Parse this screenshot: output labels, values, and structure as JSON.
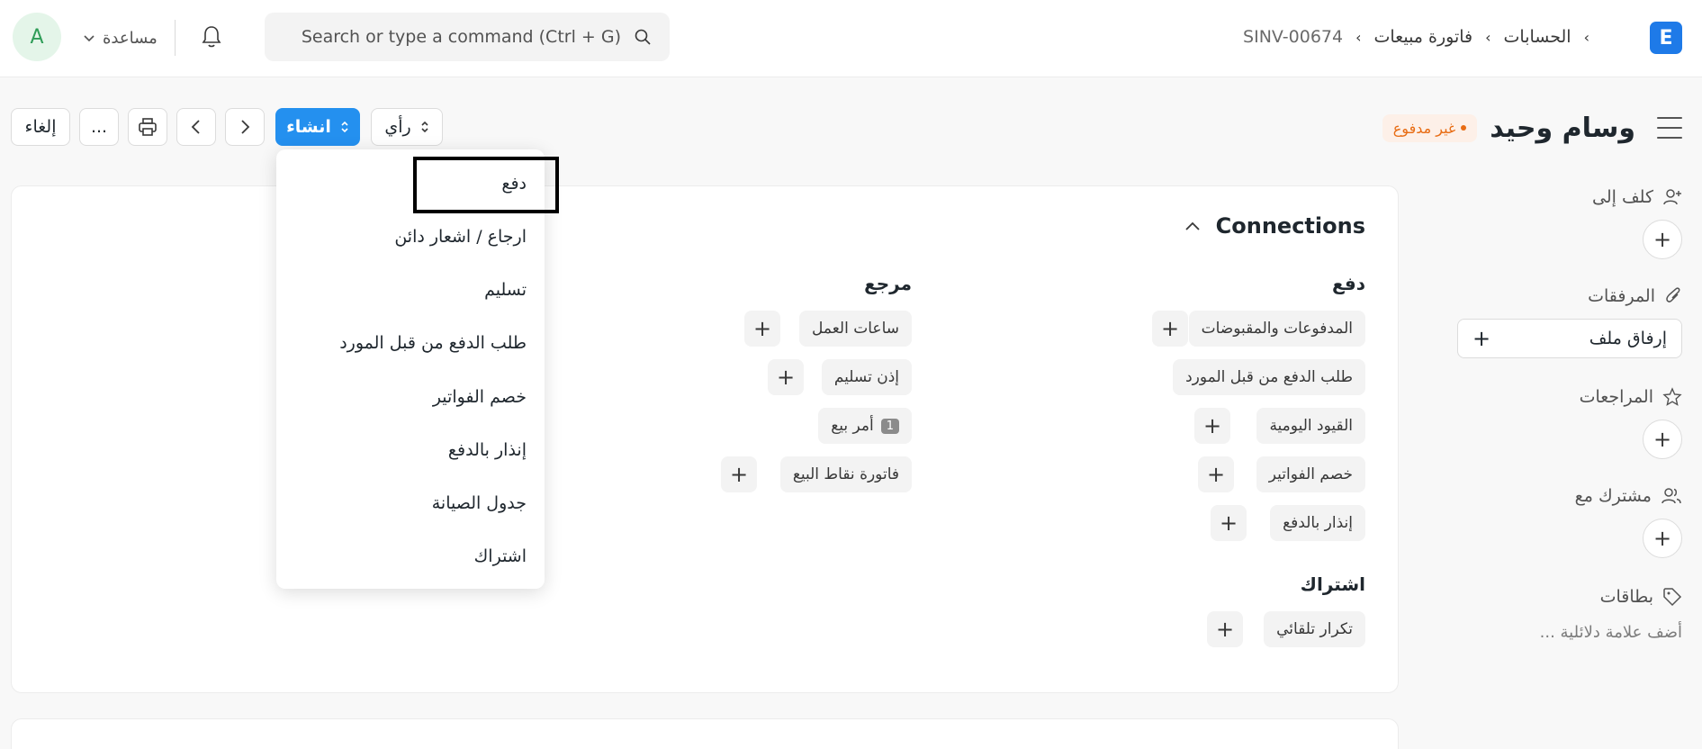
{
  "header": {
    "avatar_initial": "A",
    "help_label": "مساعدة",
    "search_placeholder": "Search or type a command (Ctrl + G)",
    "breadcrumbs": [
      "الحسابات",
      "فاتورة مبيعات",
      "SINV-00674"
    ],
    "logo_letter": "E"
  },
  "doc": {
    "title": "وسام وحيد",
    "status": "غير مدفوع"
  },
  "toolbar": {
    "cancel_label": "إلغاء",
    "more_label": "...",
    "create_label": "انشاء",
    "view_label": "رأي"
  },
  "connections": {
    "title": "Connections",
    "groups": [
      {
        "title": "دفع",
        "items": [
          "المدفوعات والمقبوضات",
          "طلب الدفع من قبل المورد",
          "القيود اليومية",
          "خصم الفواتير",
          "إنذار بالدفع"
        ]
      },
      {
        "title": "مرجع",
        "items": [
          "ساعات العمل",
          "إذن تسليم",
          "أمر بيع",
          "فاتورة نقاط البيع"
        ],
        "order_count": "1"
      },
      {
        "title": "اشتراك",
        "items": [
          "تكرار تلقائي"
        ]
      }
    ]
  },
  "sidebar": {
    "assign_label": "كلف إلى",
    "attachments_label": "المرفقات",
    "attach_file_label": "إرفاق ملف",
    "reviews_label": "المراجعات",
    "shared_label": "مشترك مع",
    "tags_label": "بطاقات",
    "tag_hint": "أضف علامة دلائلية ..."
  },
  "dropdown": {
    "items": [
      "دفع",
      "ارجاع / اشعار دائن",
      "تسليم",
      "طلب الدفع من قبل المورد",
      "خصم الفواتير",
      "إنذار بالدفع",
      "جدول الصيانة",
      "اشتراك"
    ]
  },
  "colors": {
    "primary": "#2490ef",
    "status_orange": "#e86c13",
    "avatar_green": "#2f9d58",
    "logo_blue": "#1e7ae8"
  }
}
